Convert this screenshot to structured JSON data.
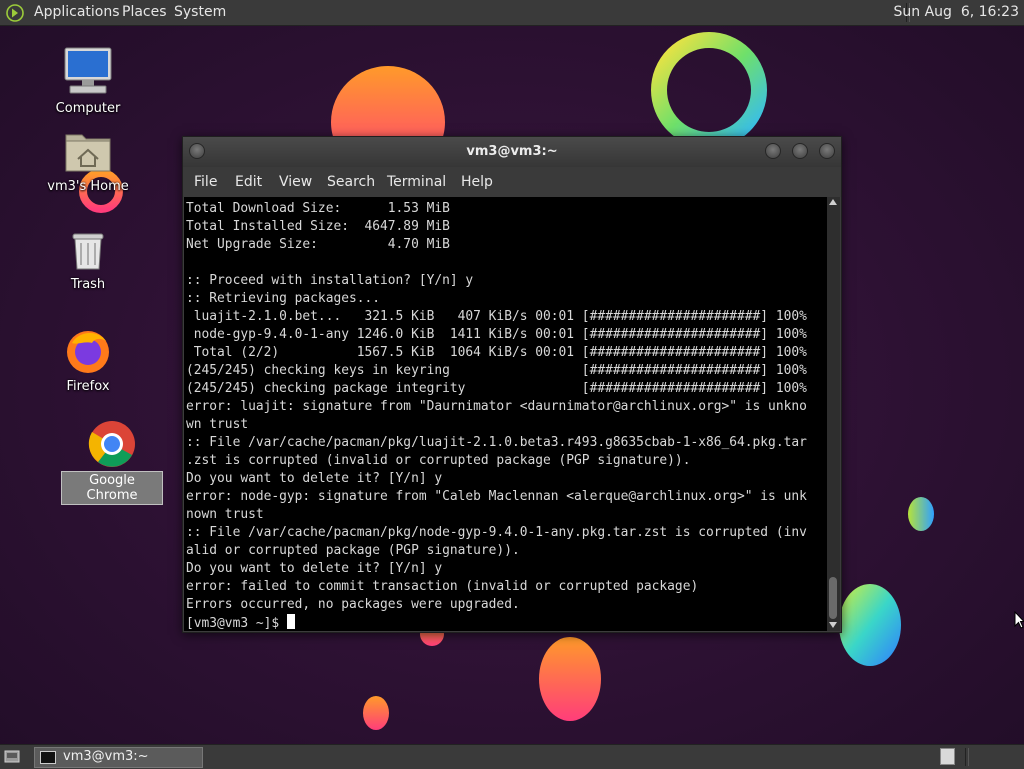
{
  "top_panel": {
    "menus": [
      "Applications",
      "Places",
      "System"
    ],
    "clock": "Sun Aug  6, 16:23"
  },
  "desktop": {
    "icons": [
      {
        "label": "Computer",
        "icon": "computer-icon"
      },
      {
        "label": "vm3's Home",
        "icon": "home-folder-icon"
      },
      {
        "label": "Trash",
        "icon": "trash-icon"
      },
      {
        "label": "Firefox",
        "icon": "firefox-icon"
      },
      {
        "label": "Google Chrome",
        "icon": "chrome-icon",
        "selected": true
      }
    ],
    "wallpaper_color": "#2a1130"
  },
  "terminal": {
    "title": "vm3@vm3:~",
    "menu": [
      "File",
      "Edit",
      "View",
      "Search",
      "Terminal",
      "Help"
    ],
    "lines": [
      "Total Download Size:      1.53 MiB",
      "Total Installed Size:  4647.89 MiB",
      "Net Upgrade Size:         4.70 MiB",
      "",
      ":: Proceed with installation? [Y/n] y",
      ":: Retrieving packages...",
      " luajit-2.1.0.bet...   321.5 KiB   407 KiB/s 00:01 [######################] 100%",
      " node-gyp-9.4.0-1-any 1246.0 KiB  1411 KiB/s 00:01 [######################] 100%",
      " Total (2/2)          1567.5 KiB  1064 KiB/s 00:01 [######################] 100%",
      "(245/245) checking keys in keyring                 [######################] 100%",
      "(245/245) checking package integrity               [######################] 100%",
      "error: luajit: signature from \"Daurnimator <daurnimator@archlinux.org>\" is unkno",
      "wn trust",
      ":: File /var/cache/pacman/pkg/luajit-2.1.0.beta3.r493.g8635cbab-1-x86_64.pkg.tar",
      ".zst is corrupted (invalid or corrupted package (PGP signature)).",
      "Do you want to delete it? [Y/n] y",
      "error: node-gyp: signature from \"Caleb Maclennan <alerque@archlinux.org>\" is unk",
      "nown trust",
      ":: File /var/cache/pacman/pkg/node-gyp-9.4.0-1-any.pkg.tar.zst is corrupted (inv",
      "alid or corrupted package (PGP signature)).",
      "Do you want to delete it? [Y/n] y",
      "error: failed to commit transaction (invalid or corrupted package)",
      "Errors occurred, no packages were upgraded."
    ],
    "prompt": "[vm3@vm3 ~]$ "
  },
  "taskbar": {
    "task_label": "vm3@vm3:~"
  }
}
